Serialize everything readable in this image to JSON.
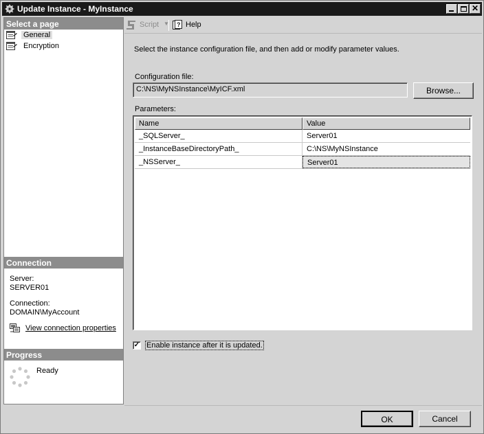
{
  "window": {
    "title": "Update Instance - MyInstance"
  },
  "select_page": {
    "heading": "Select a page",
    "items": [
      {
        "label": "General",
        "icon": "page-properties-icon",
        "selected": true
      },
      {
        "label": "Encryption",
        "icon": "page-properties-icon",
        "selected": false
      }
    ]
  },
  "connection": {
    "heading": "Connection",
    "server_label": "Server:",
    "server_value": "SERVER01",
    "connection_label": "Connection:",
    "connection_value": "DOMAIN\\MyAccount",
    "view_properties": "View connection properties"
  },
  "progress": {
    "heading": "Progress",
    "status": "Ready"
  },
  "toolbar": {
    "script_label": "Script",
    "help_label": "Help"
  },
  "main": {
    "instructions": "Select the instance configuration file, and then add or modify parameter values.",
    "config_label": "Configuration file:",
    "config_value": "C:\\NS\\MyNSInstance\\MyICF.xml",
    "browse_label": "Browse...",
    "parameters_label": "Parameters:",
    "columns": [
      "Name",
      "Value"
    ],
    "rows": [
      {
        "name": "_SQLServer_",
        "value": "Server01"
      },
      {
        "name": "_InstanceBaseDirectoryPath_",
        "value": "C:\\NS\\MyNSInstance"
      },
      {
        "name": "_NSServer_",
        "value": "Server01"
      }
    ],
    "enable_label": "Enable instance after it is updated.",
    "enable_checked": true
  },
  "buttons": {
    "ok": "OK",
    "cancel": "Cancel"
  }
}
